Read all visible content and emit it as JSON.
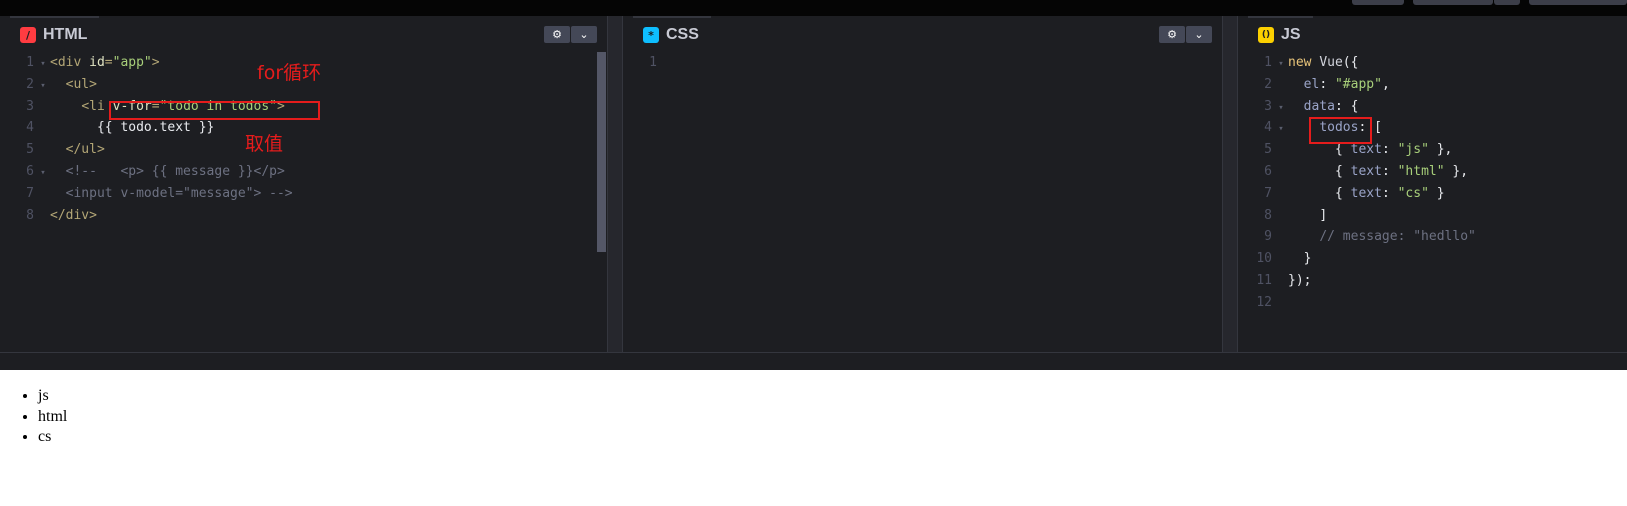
{
  "panes": {
    "html": {
      "label": "HTML",
      "icon": "/",
      "icon_color": "#ff3c41",
      "lines": [
        {
          "n": "1",
          "fold": "▾",
          "indent": "",
          "tokens": [
            [
              "t-tag",
              "<div "
            ],
            [
              "t-attr",
              "id"
            ],
            [
              "t-tag",
              "="
            ],
            [
              "t-str",
              "\"app\""
            ],
            [
              "t-tag",
              ">"
            ]
          ]
        },
        {
          "n": "2",
          "fold": "▾",
          "indent": "  ",
          "tokens": [
            [
              "t-tag",
              "<ul>"
            ]
          ]
        },
        {
          "n": "3",
          "fold": "",
          "indent": "    ",
          "tokens": [
            [
              "t-tag",
              "<li "
            ],
            [
              "t-attr",
              "v-for"
            ],
            [
              "t-tag",
              "="
            ],
            [
              "t-str",
              "\"todo in todos\""
            ],
            [
              "t-tag",
              ">"
            ]
          ]
        },
        {
          "n": "4",
          "fold": "",
          "indent": "      ",
          "tokens": [
            [
              "txt",
              "{{ todo.text }}"
            ]
          ]
        },
        {
          "n": "5",
          "fold": "",
          "indent": "  ",
          "tokens": [
            [
              "t-tag",
              "</ul>"
            ]
          ]
        },
        {
          "n": "6",
          "fold": "▾",
          "indent": "  ",
          "tokens": [
            [
              "t-cmt",
              "<!--   <p> {{ message }}</p>"
            ]
          ]
        },
        {
          "n": "7",
          "fold": "",
          "indent": "  ",
          "tokens": [
            [
              "t-cmt",
              "<input v-model=\"message\"> -->"
            ]
          ]
        },
        {
          "n": "8",
          "fold": "",
          "indent": "",
          "tokens": [
            [
              "t-tag",
              "</div>"
            ]
          ]
        }
      ]
    },
    "css": {
      "label": "CSS",
      "icon": "*",
      "icon_color": "#0ebeff",
      "lines": [
        {
          "n": "1",
          "fold": "",
          "indent": "",
          "tokens": []
        }
      ]
    },
    "js": {
      "label": "JS",
      "icon": "()",
      "icon_color": "#fcd000",
      "lines": [
        {
          "n": "1",
          "fold": "▾",
          "indent": "",
          "tokens": [
            [
              "t-key",
              "new "
            ],
            [
              "t-name",
              "Vue"
            ],
            [
              "txt",
              "({"
            ]
          ]
        },
        {
          "n": "2",
          "fold": "",
          "indent": "  ",
          "tokens": [
            [
              "t-prop",
              "el"
            ],
            [
              "txt",
              ": "
            ],
            [
              "t-str",
              "\"#app\""
            ],
            [
              "txt",
              ","
            ]
          ]
        },
        {
          "n": "3",
          "fold": "▾",
          "indent": "  ",
          "tokens": [
            [
              "t-prop",
              "data"
            ],
            [
              "txt",
              ": {"
            ]
          ]
        },
        {
          "n": "4",
          "fold": "▾",
          "indent": "    ",
          "tokens": [
            [
              "t-prop",
              "todos"
            ],
            [
              "txt",
              ": ["
            ]
          ]
        },
        {
          "n": "5",
          "fold": "",
          "indent": "      ",
          "tokens": [
            [
              "txt",
              "{ "
            ],
            [
              "t-prop",
              "text"
            ],
            [
              "txt",
              ": "
            ],
            [
              "t-str",
              "\"js\""
            ],
            [
              "txt",
              " },"
            ]
          ]
        },
        {
          "n": "6",
          "fold": "",
          "indent": "      ",
          "tokens": [
            [
              "txt",
              "{ "
            ],
            [
              "t-prop",
              "text"
            ],
            [
              "txt",
              ": "
            ],
            [
              "t-str",
              "\"html\""
            ],
            [
              "txt",
              " },"
            ]
          ]
        },
        {
          "n": "7",
          "fold": "",
          "indent": "      ",
          "tokens": [
            [
              "txt",
              "{ "
            ],
            [
              "t-prop",
              "text"
            ],
            [
              "txt",
              ": "
            ],
            [
              "t-str",
              "\"cs\""
            ],
            [
              "txt",
              " }"
            ]
          ]
        },
        {
          "n": "8",
          "fold": "",
          "indent": "    ",
          "tokens": [
            [
              "txt",
              "]"
            ]
          ]
        },
        {
          "n": "9",
          "fold": "",
          "indent": "    ",
          "tokens": [
            [
              "t-cmt",
              "// message: \"hedllo\""
            ]
          ]
        },
        {
          "n": "10",
          "fold": "",
          "indent": "  ",
          "tokens": [
            [
              "txt",
              "}"
            ]
          ]
        },
        {
          "n": "11",
          "fold": "",
          "indent": "",
          "tokens": [
            [
              "txt",
              "});"
            ]
          ]
        },
        {
          "n": "12",
          "fold": "",
          "indent": "",
          "tokens": []
        }
      ]
    }
  },
  "pane_buttons": {
    "settings_icon": "⚙",
    "expand_icon": "⌄"
  },
  "annotations": {
    "for_loop": "for循环",
    "get_value": "取值"
  },
  "preview": {
    "items": [
      "js",
      "html",
      "cs"
    ]
  }
}
